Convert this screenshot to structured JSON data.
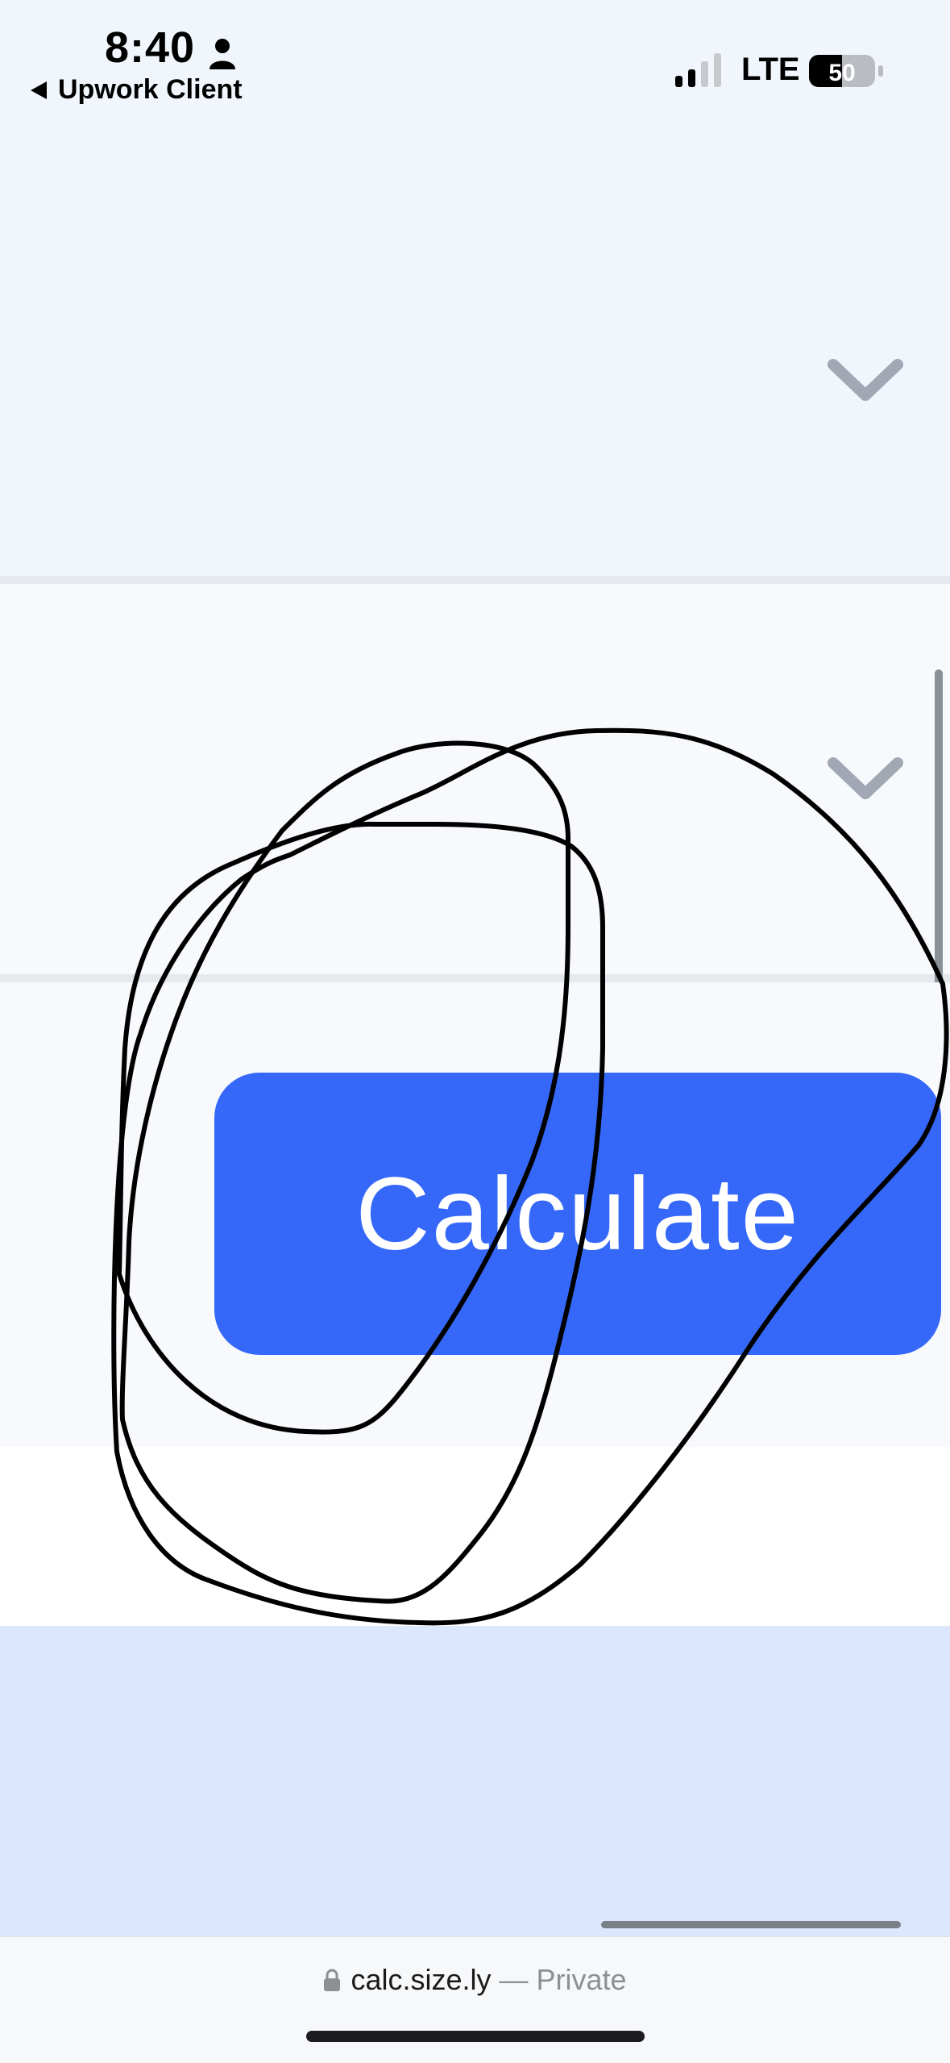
{
  "status_bar": {
    "time": "8:40",
    "back_app": "Upwork Client",
    "network": "LTE",
    "battery": "50",
    "icons": [
      "person-icon",
      "back-triangle-icon",
      "signal-icon",
      "battery-icon"
    ]
  },
  "sections": [
    {
      "icon": "chevron-down-icon"
    },
    {
      "icon": "chevron-down-icon"
    }
  ],
  "main": {
    "calculate_label": "Calculate"
  },
  "browser": {
    "domain": "calc.size.ly",
    "privacy": "— Private",
    "icon": "lock-icon"
  },
  "colors": {
    "button": "#3568f8",
    "chevron": "#a1a8b4",
    "top_background": "#f1f6fd",
    "bottom_band": "#dce7fd"
  }
}
